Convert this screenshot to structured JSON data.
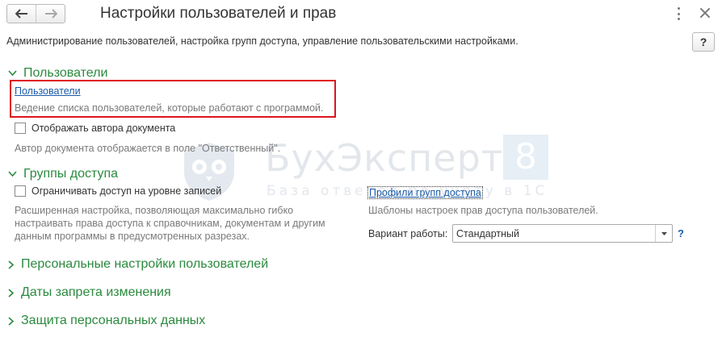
{
  "window": {
    "title": "Настройки пользователей и прав",
    "description": "Администрирование пользователей, настройка групп доступа, управление пользовательскими настройками.",
    "help_label": "?"
  },
  "icons": {
    "back": "arrow-left-icon",
    "forward": "arrow-right-icon",
    "menu": "kebab-menu-icon",
    "close": "close-icon",
    "section_expanded": "chevron-down-icon",
    "section_collapsed": "chevron-right-icon",
    "dropdown": "triangle-down-icon"
  },
  "colors": {
    "section_header": "#2a8a3e",
    "link": "#1a5aa8",
    "hint": "#7a7a7a",
    "highlight": "#e0141e"
  },
  "users": {
    "header": "Пользователи",
    "link": "Пользователи",
    "link_hint": "Ведение списка пользователей, которые работают с программой.",
    "show_author_checkbox": {
      "label": "Отображать автора документа",
      "checked": false
    },
    "show_author_hint": "Автор документа отображается в поле \"Ответственный\"."
  },
  "access_groups": {
    "header": "Группы доступа",
    "restrict_checkbox": {
      "label": "Ограничивать доступ на уровне записей",
      "checked": false
    },
    "restrict_hint_lines": [
      "Расширенная настройка, позволяющая максимально гибко",
      "настраивать права доступа к справочникам, документам и другим",
      "данным программы в предусмотренных разрезах."
    ],
    "profiles_link": "Профили групп доступа",
    "profiles_hint": "Шаблоны настроек прав доступа пользователей.",
    "variant_label": "Вариант работы:",
    "variant_value": "Стандартный",
    "variant_help": "?"
  },
  "collapsed_sections": [
    "Персональные настройки пользователей",
    "Даты запрета изменения",
    "Защита персональных данных"
  ],
  "watermark": {
    "brand": "БухЭксперт",
    "badge": "8",
    "tagline": "База ответов по учету в 1С"
  }
}
